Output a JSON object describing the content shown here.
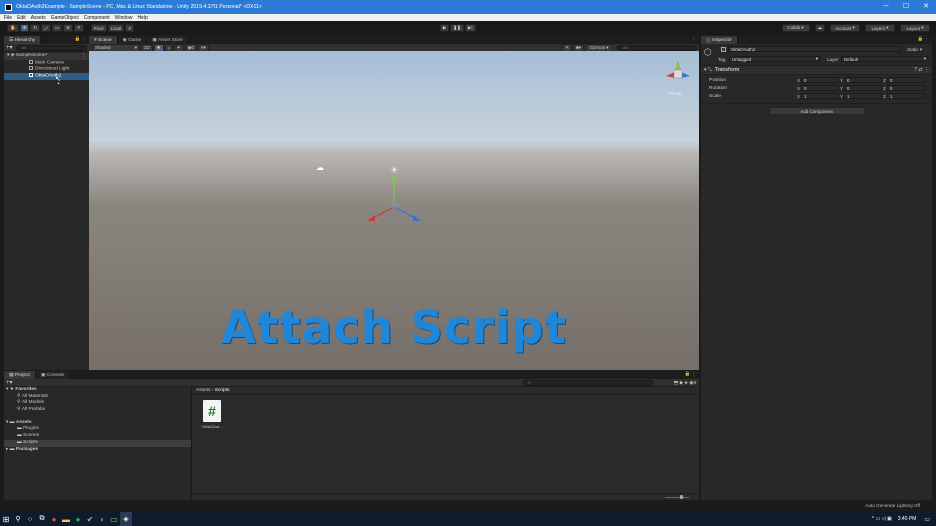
{
  "window": {
    "title": "OktaOAuth2Example - SampleScene - PC, Mac & Linux Standalone - Unity 2019.4.37f1 Personal* <DX11>",
    "controls": {
      "minimize": "─",
      "maximize": "☐",
      "close": "✕"
    }
  },
  "menu": [
    "File",
    "Edit",
    "Assets",
    "GameObject",
    "Component",
    "Window",
    "Help"
  ],
  "toolbar": {
    "pivot": "Pivot",
    "local": "Local",
    "collab": "Collab ▾",
    "account": "Account",
    "layers": "Layers",
    "layout": "Layout"
  },
  "hierarchy": {
    "tab": "Hierarchy",
    "search_placeholder": "All",
    "scene": "SampleScene*",
    "items": [
      "Main Camera",
      "Directional Light",
      "OktaOAuth2"
    ],
    "selected": "OktaOAuth2"
  },
  "scene": {
    "tabs": [
      "Scene",
      "Game",
      "Asset Store"
    ],
    "shading": "Shaded",
    "dim": "2D",
    "gizmos": "Gizmos",
    "search_placeholder": "All",
    "persp": "<Persp",
    "overlay": "Attach Script"
  },
  "inspector": {
    "tab": "Inspector",
    "object_name": "OktaOAuth2",
    "static_label": "Static",
    "tag_label": "Tag",
    "tag_value": "Untagged",
    "layer_label": "Layer",
    "layer_value": "Default",
    "component": "Transform",
    "rows": [
      {
        "label": "Position",
        "x": "0",
        "y": "0",
        "z": "0"
      },
      {
        "label": "Rotation",
        "x": "0",
        "y": "0",
        "z": "0"
      },
      {
        "label": "Scale",
        "x": "1",
        "y": "1",
        "z": "1"
      }
    ],
    "add_component": "Add Component"
  },
  "project": {
    "tabs": [
      "Project",
      "Console"
    ],
    "favorites": "Favorites",
    "fav_items": [
      "All Materials",
      "All Models",
      "All Prefabs"
    ],
    "assets": "Assets",
    "asset_folders": [
      "Plugins",
      "Scenes",
      "Scripts"
    ],
    "packages": "Packages",
    "breadcrumb_root": "Assets",
    "breadcrumb_sep": "›",
    "breadcrumb_current": "Scripts",
    "file_name": "OktaOAut...",
    "badge": "8"
  },
  "status": {
    "right": "Auto Generate Lighting Off"
  },
  "taskbar": {
    "time": "3:40 PM"
  },
  "colors": {
    "accent": "#2b7bd6",
    "selection": "#2c5d87",
    "overlay_text": "#1f86d8"
  }
}
